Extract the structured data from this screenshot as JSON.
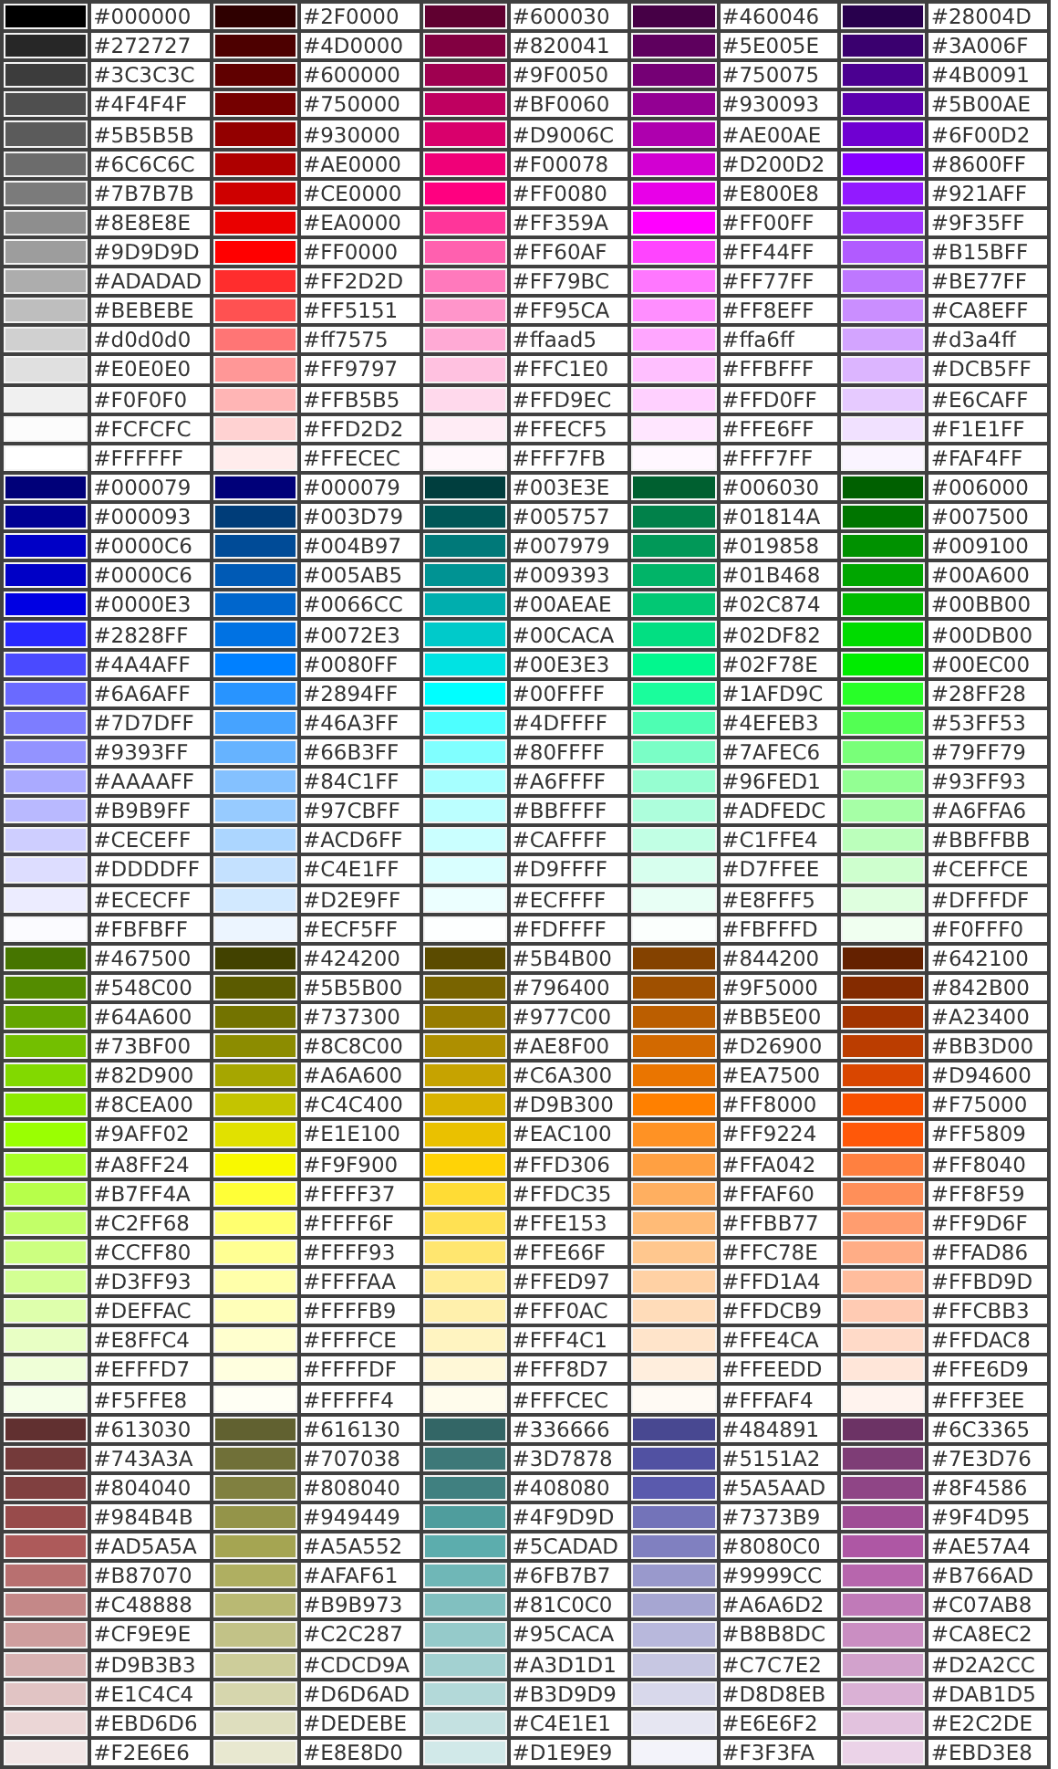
{
  "blocks": [
    {
      "columns": [
        {
          "cells": [
            {
              "label": "#000000",
              "color": "#000000"
            },
            {
              "label": "#272727",
              "color": "#272727"
            },
            {
              "label": "#3C3C3C",
              "color": "#3c3c3c"
            },
            {
              "label": "#4F4F4F",
              "color": "#4f4f4f"
            },
            {
              "label": "#5B5B5B",
              "color": "#5b5b5b"
            },
            {
              "label": "#6C6C6C",
              "color": "#6c6c6c"
            },
            {
              "label": "#7B7B7B",
              "color": "#7b7b7b"
            },
            {
              "label": "#8E8E8E",
              "color": "#8e8e8e"
            },
            {
              "label": "#9D9D9D",
              "color": "#9d9d9d"
            },
            {
              "label": "#ADADAD",
              "color": "#adadad"
            },
            {
              "label": "#BEBEBE",
              "color": "#bebebe"
            },
            {
              "label": "#d0d0d0",
              "color": "#d0d0d0"
            },
            {
              "label": "#E0E0E0",
              "color": "#e0e0e0"
            },
            {
              "label": "#F0F0F0",
              "color": "#f0f0f0"
            },
            {
              "label": "#FCFCFC",
              "color": "#fcfcfc"
            },
            {
              "label": "#FFFFFF",
              "color": "#ffffff"
            }
          ]
        },
        {
          "cells": [
            {
              "label": "#2F0000",
              "color": "#2f0000"
            },
            {
              "label": "#4D0000",
              "color": "#4d0000"
            },
            {
              "label": "#600000",
              "color": "#600000"
            },
            {
              "label": "#750000",
              "color": "#750000"
            },
            {
              "label": "#930000",
              "color": "#930000"
            },
            {
              "label": "#AE0000",
              "color": "#ae0000"
            },
            {
              "label": "#CE0000",
              "color": "#ce0000"
            },
            {
              "label": "#EA0000",
              "color": "#ea0000"
            },
            {
              "label": "#FF0000",
              "color": "#ff0000"
            },
            {
              "label": "#FF2D2D",
              "color": "#ff2d2d"
            },
            {
              "label": "#FF5151",
              "color": "#ff5151"
            },
            {
              "label": "#ff7575",
              "color": "#ff7575"
            },
            {
              "label": "#FF9797",
              "color": "#ff9797"
            },
            {
              "label": "#FFB5B5",
              "color": "#ffb5b5"
            },
            {
              "label": "#FFD2D2",
              "color": "#ffd2d2"
            },
            {
              "label": "#FFECEC",
              "color": "#ffecec"
            }
          ]
        },
        {
          "cells": [
            {
              "label": "#600030",
              "color": "#600030"
            },
            {
              "label": "#820041",
              "color": "#820041"
            },
            {
              "label": "#9F0050",
              "color": "#9f0050"
            },
            {
              "label": "#BF0060",
              "color": "#bf0060"
            },
            {
              "label": "#D9006C",
              "color": "#d9006c"
            },
            {
              "label": "#F00078",
              "color": "#f00078"
            },
            {
              "label": "#FF0080",
              "color": "#ff0080"
            },
            {
              "label": "#FF359A",
              "color": "#ff359a"
            },
            {
              "label": "#FF60AF",
              "color": "#ff60af"
            },
            {
              "label": "#FF79BC",
              "color": "#ff79bc"
            },
            {
              "label": "#FF95CA",
              "color": "#ff95ca"
            },
            {
              "label": "#ffaad5",
              "color": "#ffaad5"
            },
            {
              "label": "#FFC1E0",
              "color": "#ffc1e0"
            },
            {
              "label": "#FFD9EC",
              "color": "#ffd9ec"
            },
            {
              "label": "#FFECF5",
              "color": "#ffecf5"
            },
            {
              "label": "#FFF7FB",
              "color": "#fff7fb"
            }
          ]
        },
        {
          "cells": [
            {
              "label": "#460046",
              "color": "#460046"
            },
            {
              "label": "#5E005E",
              "color": "#5e005e"
            },
            {
              "label": "#750075",
              "color": "#750075"
            },
            {
              "label": "#930093",
              "color": "#930093"
            },
            {
              "label": "#AE00AE",
              "color": "#ae00ae"
            },
            {
              "label": "#D200D2",
              "color": "#d200d2"
            },
            {
              "label": "#E800E8",
              "color": "#e800e8"
            },
            {
              "label": "#FF00FF",
              "color": "#ff00ff"
            },
            {
              "label": "#FF44FF",
              "color": "#ff44ff"
            },
            {
              "label": "#FF77FF",
              "color": "#ff77ff"
            },
            {
              "label": "#FF8EFF",
              "color": "#ff8eff"
            },
            {
              "label": "#ffa6ff",
              "color": "#ffa6ff"
            },
            {
              "label": "#FFBFFF",
              "color": "#ffbfff"
            },
            {
              "label": "#FFD0FF",
              "color": "#ffd0ff"
            },
            {
              "label": "#FFE6FF",
              "color": "#ffe6ff"
            },
            {
              "label": "#FFF7FF",
              "color": "#fff7ff"
            }
          ]
        },
        {
          "cells": [
            {
              "label": "#28004D",
              "color": "#28004d"
            },
            {
              "label": "#3A006F",
              "color": "#3a006f"
            },
            {
              "label": "#4B0091",
              "color": "#4b0091"
            },
            {
              "label": "#5B00AE",
              "color": "#5b00ae"
            },
            {
              "label": "#6F00D2",
              "color": "#6f00d2"
            },
            {
              "label": "#8600FF",
              "color": "#8600ff"
            },
            {
              "label": "#921AFF",
              "color": "#921aff"
            },
            {
              "label": "#9F35FF",
              "color": "#9f35ff"
            },
            {
              "label": "#B15BFF",
              "color": "#b15bff"
            },
            {
              "label": "#BE77FF",
              "color": "#be77ff"
            },
            {
              "label": "#CA8EFF",
              "color": "#ca8eff"
            },
            {
              "label": "#d3a4ff",
              "color": "#d3a4ff"
            },
            {
              "label": "#DCB5FF",
              "color": "#dcb5ff"
            },
            {
              "label": "#E6CAFF",
              "color": "#e6caff"
            },
            {
              "label": "#F1E1FF",
              "color": "#f1e1ff"
            },
            {
              "label": "#FAF4FF",
              "color": "#faf4ff"
            }
          ]
        }
      ]
    },
    {
      "columns": [
        {
          "cells": [
            {
              "label": "#000079",
              "color": "#000079"
            },
            {
              "label": "#000093",
              "color": "#000093"
            },
            {
              "label": "#0000C6",
              "color": "#0000c6"
            },
            {
              "label": "#0000C6",
              "color": "#0000c6"
            },
            {
              "label": "#0000E3",
              "color": "#0000e3"
            },
            {
              "label": "#2828FF",
              "color": "#2828ff"
            },
            {
              "label": "#4A4AFF",
              "color": "#4a4aff"
            },
            {
              "label": "#6A6AFF",
              "color": "#6a6aff"
            },
            {
              "label": "#7D7DFF",
              "color": "#7d7dff"
            },
            {
              "label": "#9393FF",
              "color": "#9393ff"
            },
            {
              "label": "#AAAAFF",
              "color": "#aaaaff"
            },
            {
              "label": "#B9B9FF",
              "color": "#b9b9ff"
            },
            {
              "label": "#CECEFF",
              "color": "#ceceff"
            },
            {
              "label": "#DDDDFF",
              "color": "#ddddff"
            },
            {
              "label": "#ECECFF",
              "color": "#ececff"
            },
            {
              "label": "#FBFBFF",
              "color": "#fbfbff"
            }
          ]
        },
        {
          "cells": [
            {
              "label": "#000079",
              "color": "#000079"
            },
            {
              "label": "#003D79",
              "color": "#003d79"
            },
            {
              "label": "#004B97",
              "color": "#004b97"
            },
            {
              "label": "#005AB5",
              "color": "#005ab5"
            },
            {
              "label": "#0066CC",
              "color": "#0066cc"
            },
            {
              "label": "#0072E3",
              "color": "#0072e3"
            },
            {
              "label": "#0080FF",
              "color": "#0080ff"
            },
            {
              "label": "#2894FF",
              "color": "#2894ff"
            },
            {
              "label": "#46A3FF",
              "color": "#46a3ff"
            },
            {
              "label": "#66B3FF",
              "color": "#66b3ff"
            },
            {
              "label": "#84C1FF",
              "color": "#84c1ff"
            },
            {
              "label": "#97CBFF",
              "color": "#97cbff"
            },
            {
              "label": "#ACD6FF",
              "color": "#acd6ff"
            },
            {
              "label": "#C4E1FF",
              "color": "#c4e1ff"
            },
            {
              "label": "#D2E9FF",
              "color": "#d2e9ff"
            },
            {
              "label": "#ECF5FF",
              "color": "#ecf5ff"
            }
          ]
        },
        {
          "cells": [
            {
              "label": "#003E3E",
              "color": "#003e3e"
            },
            {
              "label": "#005757",
              "color": "#005757"
            },
            {
              "label": "#007979",
              "color": "#007979"
            },
            {
              "label": "#009393",
              "color": "#009393"
            },
            {
              "label": "#00AEAE",
              "color": "#00aeae"
            },
            {
              "label": "#00CACA",
              "color": "#00caca"
            },
            {
              "label": "#00E3E3",
              "color": "#00e3e3"
            },
            {
              "label": "#00FFFF",
              "color": "#00ffff"
            },
            {
              "label": "#4DFFFF",
              "color": "#4dffff"
            },
            {
              "label": "#80FFFF",
              "color": "#80ffff"
            },
            {
              "label": "#A6FFFF",
              "color": "#a6ffff"
            },
            {
              "label": "#BBFFFF",
              "color": "#bbffff"
            },
            {
              "label": "#CAFFFF",
              "color": "#caffff"
            },
            {
              "label": "#D9FFFF",
              "color": "#d9ffff"
            },
            {
              "label": "#ECFFFF",
              "color": "#ecffff"
            },
            {
              "label": "#FDFFFF",
              "color": "#fdffff"
            }
          ]
        },
        {
          "cells": [
            {
              "label": "#006030",
              "color": "#006030"
            },
            {
              "label": "#01814A",
              "color": "#01814a"
            },
            {
              "label": "#019858",
              "color": "#019858"
            },
            {
              "label": "#01B468",
              "color": "#01b468"
            },
            {
              "label": "#02C874",
              "color": "#02c874"
            },
            {
              "label": "#02DF82",
              "color": "#02df82"
            },
            {
              "label": "#02F78E",
              "color": "#02f78e"
            },
            {
              "label": "#1AFD9C",
              "color": "#1afd9c"
            },
            {
              "label": "#4EFEB3",
              "color": "#4efeb3"
            },
            {
              "label": "#7AFEC6",
              "color": "#7afec6"
            },
            {
              "label": "#96FED1",
              "color": "#96fed1"
            },
            {
              "label": "#ADFEDC",
              "color": "#adfedc"
            },
            {
              "label": "#C1FFE4",
              "color": "#c1ffe4"
            },
            {
              "label": "#D7FFEE",
              "color": "#d7ffee"
            },
            {
              "label": "#E8FFF5",
              "color": "#e8fff5"
            },
            {
              "label": "#FBFFFD",
              "color": "#fbfffd"
            }
          ]
        },
        {
          "cells": [
            {
              "label": "#006000",
              "color": "#006000"
            },
            {
              "label": "#007500",
              "color": "#007500"
            },
            {
              "label": "#009100",
              "color": "#009100"
            },
            {
              "label": "#00A600",
              "color": "#00a600"
            },
            {
              "label": "#00BB00",
              "color": "#00bb00"
            },
            {
              "label": "#00DB00",
              "color": "#00db00"
            },
            {
              "label": "#00EC00",
              "color": "#00ec00"
            },
            {
              "label": "#28FF28",
              "color": "#28ff28"
            },
            {
              "label": "#53FF53",
              "color": "#53ff53"
            },
            {
              "label": "#79FF79",
              "color": "#79ff79"
            },
            {
              "label": "#93FF93",
              "color": "#93ff93"
            },
            {
              "label": "#A6FFA6",
              "color": "#a6ffa6"
            },
            {
              "label": "#BBFFBB",
              "color": "#bbffbb"
            },
            {
              "label": "#CEFFCE",
              "color": "#ceffce"
            },
            {
              "label": "#DFFFDF",
              "color": "#dfffdf"
            },
            {
              "label": "#F0FFF0",
              "color": "#f0fff0"
            }
          ]
        }
      ]
    },
    {
      "columns": [
        {
          "cells": [
            {
              "label": "#467500",
              "color": "#467500"
            },
            {
              "label": "#548C00",
              "color": "#548c00"
            },
            {
              "label": "#64A600",
              "color": "#64a600"
            },
            {
              "label": "#73BF00",
              "color": "#73bf00"
            },
            {
              "label": "#82D900",
              "color": "#82d900"
            },
            {
              "label": "#8CEA00",
              "color": "#8cea00"
            },
            {
              "label": "#9AFF02",
              "color": "#9aff02"
            },
            {
              "label": "#A8FF24",
              "color": "#a8ff24"
            },
            {
              "label": "#B7FF4A",
              "color": "#b7ff4a"
            },
            {
              "label": "#C2FF68",
              "color": "#c2ff68"
            },
            {
              "label": "#CCFF80",
              "color": "#ccff80"
            },
            {
              "label": "#D3FF93",
              "color": "#d3ff93"
            },
            {
              "label": "#DEFFAC",
              "color": "#deffac"
            },
            {
              "label": "#E8FFC4",
              "color": "#e8ffc4"
            },
            {
              "label": "#EFFFD7",
              "color": "#efffd7"
            },
            {
              "label": "#F5FFE8",
              "color": "#f5ffe8"
            }
          ]
        },
        {
          "cells": [
            {
              "label": "#424200",
              "color": "#424200"
            },
            {
              "label": "#5B5B00",
              "color": "#5b5b00"
            },
            {
              "label": "#737300",
              "color": "#737300"
            },
            {
              "label": "#8C8C00",
              "color": "#8c8c00"
            },
            {
              "label": "#A6A600",
              "color": "#a6a600"
            },
            {
              "label": "#C4C400",
              "color": "#c4c400"
            },
            {
              "label": "#E1E100",
              "color": "#e1e100"
            },
            {
              "label": "#F9F900",
              "color": "#f9f900"
            },
            {
              "label": "#FFFF37",
              "color": "#ffff37"
            },
            {
              "label": "#FFFF6F",
              "color": "#ffff6f"
            },
            {
              "label": "#FFFF93",
              "color": "#ffff93"
            },
            {
              "label": "#FFFFAA",
              "color": "#ffffaa"
            },
            {
              "label": "#FFFFB9",
              "color": "#ffffb9"
            },
            {
              "label": "#FFFFCE",
              "color": "#ffffce"
            },
            {
              "label": "#FFFFDF",
              "color": "#ffffdf"
            },
            {
              "label": "#FFFFF4",
              "color": "#fffff4"
            }
          ]
        },
        {
          "cells": [
            {
              "label": "#5B4B00",
              "color": "#5b4b00"
            },
            {
              "label": "#796400",
              "color": "#796400"
            },
            {
              "label": "#977C00",
              "color": "#977c00"
            },
            {
              "label": "#AE8F00",
              "color": "#ae8f00"
            },
            {
              "label": "#C6A300",
              "color": "#c6a300"
            },
            {
              "label": "#D9B300",
              "color": "#d9b300"
            },
            {
              "label": "#EAC100",
              "color": "#eac100"
            },
            {
              "label": "#FFD306",
              "color": "#ffd306"
            },
            {
              "label": "#FFDC35",
              "color": "#ffdc35"
            },
            {
              "label": "#FFE153",
              "color": "#ffe153"
            },
            {
              "label": "#FFE66F",
              "color": "#ffe66f"
            },
            {
              "label": "#FFED97",
              "color": "#ffed97"
            },
            {
              "label": "#FFF0AC",
              "color": "#fff0ac"
            },
            {
              "label": "#FFF4C1",
              "color": "#fff4c1"
            },
            {
              "label": "#FFF8D7",
              "color": "#fff8d7"
            },
            {
              "label": "#FFFCEC",
              "color": "#fffcec"
            }
          ]
        },
        {
          "cells": [
            {
              "label": "#844200",
              "color": "#844200"
            },
            {
              "label": "#9F5000",
              "color": "#9f5000"
            },
            {
              "label": "#BB5E00",
              "color": "#bb5e00"
            },
            {
              "label": "#D26900",
              "color": "#d26900"
            },
            {
              "label": "#EA7500",
              "color": "#ea7500"
            },
            {
              "label": "#FF8000",
              "color": "#ff8000"
            },
            {
              "label": "#FF9224",
              "color": "#ff9224"
            },
            {
              "label": "#FFA042",
              "color": "#ffa042"
            },
            {
              "label": "#FFAF60",
              "color": "#ffaf60"
            },
            {
              "label": "#FFBB77",
              "color": "#ffbb77"
            },
            {
              "label": "#FFC78E",
              "color": "#ffc78e"
            },
            {
              "label": "#FFD1A4",
              "color": "#ffd1a4"
            },
            {
              "label": "#FFDCB9",
              "color": "#ffdcb9"
            },
            {
              "label": "#FFE4CA",
              "color": "#ffe4ca"
            },
            {
              "label": "#FFEEDD",
              "color": "#ffeedd"
            },
            {
              "label": "#FFFAF4",
              "color": "#fffaf4"
            }
          ]
        },
        {
          "cells": [
            {
              "label": "#642100",
              "color": "#642100"
            },
            {
              "label": "#842B00",
              "color": "#842b00"
            },
            {
              "label": "#A23400",
              "color": "#a23400"
            },
            {
              "label": "#BB3D00",
              "color": "#bb3d00"
            },
            {
              "label": "#D94600",
              "color": "#d94600"
            },
            {
              "label": "#F75000",
              "color": "#f75000"
            },
            {
              "label": "#FF5809",
              "color": "#ff5809"
            },
            {
              "label": "#FF8040",
              "color": "#ff8040"
            },
            {
              "label": "#FF8F59",
              "color": "#ff8f59"
            },
            {
              "label": "#FF9D6F",
              "color": "#ff9d6f"
            },
            {
              "label": "#FFAD86",
              "color": "#ffad86"
            },
            {
              "label": "#FFBD9D",
              "color": "#ffbd9d"
            },
            {
              "label": "#FFCBB3",
              "color": "#ffcbb3"
            },
            {
              "label": "#FFDAC8",
              "color": "#ffdac8"
            },
            {
              "label": "#FFE6D9",
              "color": "#ffe6d9"
            },
            {
              "label": "#FFF3EE",
              "color": "#fff3ee"
            }
          ]
        }
      ]
    },
    {
      "columns": [
        {
          "cells": [
            {
              "label": "#613030",
              "color": "#613030"
            },
            {
              "label": "#743A3A",
              "color": "#743a3a"
            },
            {
              "label": "#804040",
              "color": "#804040"
            },
            {
              "label": "#984B4B",
              "color": "#984b4b"
            },
            {
              "label": "#AD5A5A",
              "color": "#ad5a5a"
            },
            {
              "label": "#B87070",
              "color": "#b87070"
            },
            {
              "label": "#C48888",
              "color": "#c48888"
            },
            {
              "label": "#CF9E9E",
              "color": "#cf9e9e"
            },
            {
              "label": "#D9B3B3",
              "color": "#d9b3b3"
            },
            {
              "label": "#E1C4C4",
              "color": "#e1c4c4"
            },
            {
              "label": "#EBD6D6",
              "color": "#ebd6d6"
            },
            {
              "label": "#F2E6E6",
              "color": "#f2e6e6"
            }
          ]
        },
        {
          "cells": [
            {
              "label": "#616130",
              "color": "#616130"
            },
            {
              "label": "#707038",
              "color": "#707038"
            },
            {
              "label": "#808040",
              "color": "#808040"
            },
            {
              "label": "#949449",
              "color": "#949449"
            },
            {
              "label": "#A5A552",
              "color": "#a5a552"
            },
            {
              "label": "#AFAF61",
              "color": "#afaf61"
            },
            {
              "label": "#B9B973",
              "color": "#b9b973"
            },
            {
              "label": "#C2C287",
              "color": "#c2c287"
            },
            {
              "label": "#CDCD9A",
              "color": "#cdcd9a"
            },
            {
              "label": "#D6D6AD",
              "color": "#d6d6ad"
            },
            {
              "label": "#DEDEBE",
              "color": "#dedebe"
            },
            {
              "label": "#E8E8D0",
              "color": "#e8e8d0"
            }
          ]
        },
        {
          "cells": [
            {
              "label": "#336666",
              "color": "#336666"
            },
            {
              "label": "#3D7878",
              "color": "#3d7878"
            },
            {
              "label": "#408080",
              "color": "#408080"
            },
            {
              "label": "#4F9D9D",
              "color": "#4f9d9d"
            },
            {
              "label": "#5CADAD",
              "color": "#5cadad"
            },
            {
              "label": "#6FB7B7",
              "color": "#6fb7b7"
            },
            {
              "label": "#81C0C0",
              "color": "#81c0c0"
            },
            {
              "label": "#95CACA",
              "color": "#95caca"
            },
            {
              "label": "#A3D1D1",
              "color": "#a3d1d1"
            },
            {
              "label": "#B3D9D9",
              "color": "#b3d9d9"
            },
            {
              "label": "#C4E1E1",
              "color": "#c4e1e1"
            },
            {
              "label": "#D1E9E9",
              "color": "#d1e9e9"
            }
          ]
        },
        {
          "cells": [
            {
              "label": "#484891",
              "color": "#484891"
            },
            {
              "label": "#5151A2",
              "color": "#5151a2"
            },
            {
              "label": "#5A5AAD",
              "color": "#5a5aad"
            },
            {
              "label": "#7373B9",
              "color": "#7373b9"
            },
            {
              "label": "#8080C0",
              "color": "#8080c0"
            },
            {
              "label": "#9999CC",
              "color": "#9999cc"
            },
            {
              "label": "#A6A6D2",
              "color": "#a6a6d2"
            },
            {
              "label": "#B8B8DC",
              "color": "#b8b8dc"
            },
            {
              "label": "#C7C7E2",
              "color": "#c7c7e2"
            },
            {
              "label": "#D8D8EB",
              "color": "#d8d8eb"
            },
            {
              "label": "#E6E6F2",
              "color": "#e6e6f2"
            },
            {
              "label": "#F3F3FA",
              "color": "#f3f3fa"
            }
          ]
        },
        {
          "cells": [
            {
              "label": "#6C3365",
              "color": "#6c3365"
            },
            {
              "label": "#7E3D76",
              "color": "#7e3d76"
            },
            {
              "label": "#8F4586",
              "color": "#8f4586"
            },
            {
              "label": "#9F4D95",
              "color": "#9f4d95"
            },
            {
              "label": "#AE57A4",
              "color": "#ae57a4"
            },
            {
              "label": "#B766AD",
              "color": "#b766ad"
            },
            {
              "label": "#C07AB8",
              "color": "#c07ab8"
            },
            {
              "label": "#CA8EC2",
              "color": "#ca8ec2"
            },
            {
              "label": "#D2A2CC",
              "color": "#d2a2cc"
            },
            {
              "label": "#DAB1D5",
              "color": "#dab1d5"
            },
            {
              "label": "#E2C2DE",
              "color": "#e2c2de"
            },
            {
              "label": "#EBD3E8",
              "color": "#ebd3e8"
            }
          ]
        }
      ]
    }
  ]
}
